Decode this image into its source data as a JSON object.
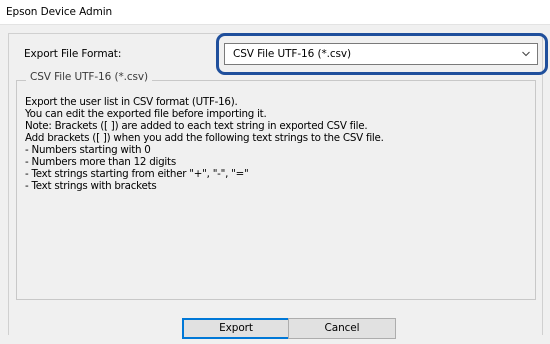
{
  "window": {
    "title": "Epson Device Admin"
  },
  "export_format": {
    "label": "Export File Format:",
    "selected": "CSV File UTF-16 (*.csv)",
    "icon": "chevron-down-icon",
    "highlight_color": "#1f4f9c"
  },
  "description_group": {
    "legend": "CSV File UTF-16 (*.csv)",
    "lines": [
      "Export the user list in CSV format (UTF-16).",
      "You can edit the exported file before importing it.",
      "Note: Brackets ([ ]) are added to each text string in exported CSV file.",
      "Add brackets ([ ]) when you add the following text strings to the CSV file.",
      "- Numbers starting with 0",
      "- Numbers more than 12 digits",
      "- Text strings starting from either \"+\", \"-\", \"=\"",
      "- Text strings with brackets"
    ]
  },
  "buttons": {
    "export_label": "Export",
    "cancel_label": "Cancel",
    "accent_color": "#0078d7"
  }
}
